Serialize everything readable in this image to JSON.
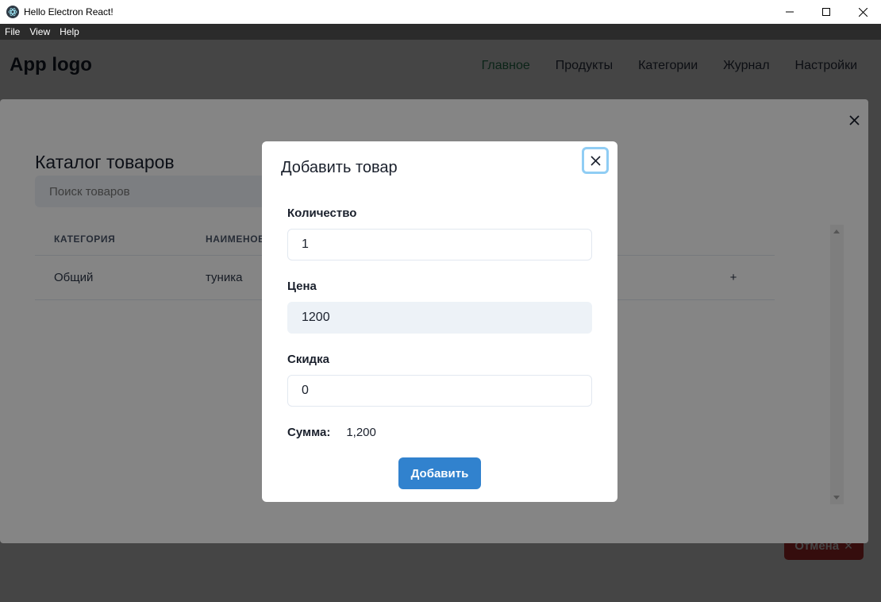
{
  "window": {
    "title": "Hello Electron React!",
    "menu": [
      "File",
      "View",
      "Help"
    ]
  },
  "header": {
    "logo": "App logo",
    "nav": [
      {
        "label": "Главное",
        "active": true
      },
      {
        "label": "Продукты",
        "active": false
      },
      {
        "label": "Категории",
        "active": false
      },
      {
        "label": "Журнал",
        "active": false
      },
      {
        "label": "Настройки",
        "active": false
      }
    ]
  },
  "background": {
    "cancel_label": "Отмена"
  },
  "catalog": {
    "title": "Каталог товаров",
    "search_placeholder": "Поиск товаров",
    "columns": [
      "Категория",
      "Наименование"
    ],
    "rows": [
      {
        "category": "Общий",
        "name": "туника",
        "action": "+"
      }
    ]
  },
  "dialog": {
    "title": "Добавить товар",
    "fields": [
      {
        "label": "Количество",
        "value": "1",
        "readonly": false
      },
      {
        "label": "Цена",
        "value": "1200",
        "readonly": true
      },
      {
        "label": "Скидка",
        "value": "0",
        "readonly": false
      }
    ],
    "sum_label": "Сумма:",
    "sum_value": "1,200",
    "submit_label": "Добавить"
  },
  "colors": {
    "nav_active": "#2f855a",
    "primary_button": "#3182ce",
    "cancel_button": "#c53030",
    "focus_ring": "#90cdf4"
  }
}
